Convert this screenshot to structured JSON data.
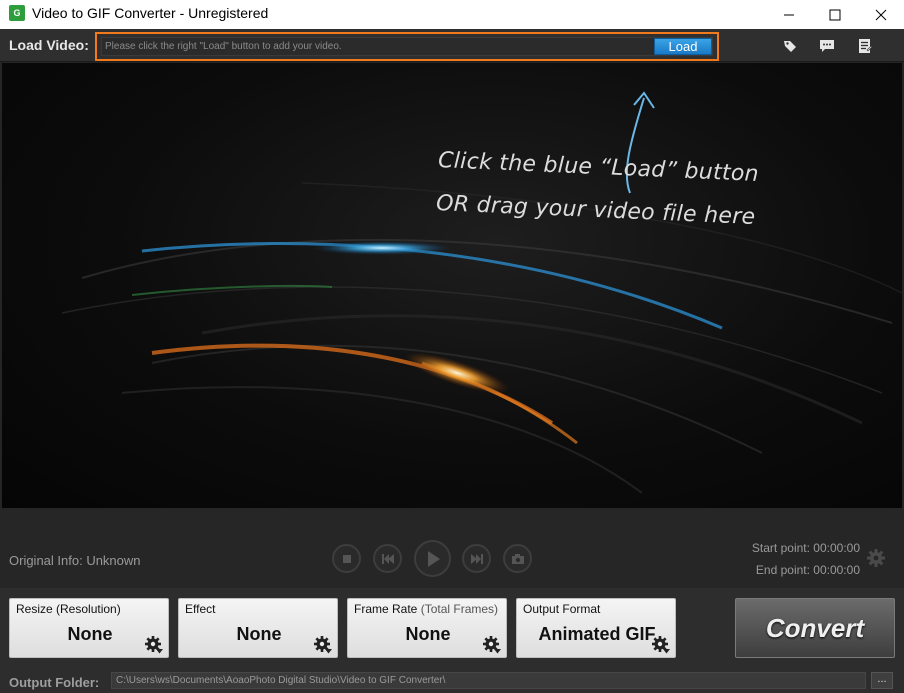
{
  "window": {
    "logo_text": "G",
    "title": "Video to GIF Converter - Unregistered"
  },
  "load_bar": {
    "label": "Load Video:",
    "placeholder": "Please click the right \"Load\" button to add your video.",
    "button_label": "Load",
    "icons": [
      "tag-icon",
      "chat-icon",
      "notes-icon"
    ]
  },
  "preview": {
    "hint_line1": "Click the blue “Load” button",
    "hint_line2": "OR drag your video file here"
  },
  "info": {
    "original_info": "Original Info: Unknown",
    "start_point": "Start point: 00:00:00",
    "end_point": "End point: 00:00:00"
  },
  "playback": [
    "stop-icon",
    "previous-frame-icon",
    "play-icon",
    "next-frame-icon",
    "snapshot-icon"
  ],
  "options": {
    "resize": {
      "title": "Resize (Resolution)",
      "value": "None"
    },
    "effect": {
      "title": "Effect",
      "value": "None"
    },
    "frame_rate": {
      "title": "Frame Rate",
      "title_sub": "(Total Frames)",
      "value": "None"
    },
    "output_format": {
      "title": "Output Format",
      "value": "Animated GIF"
    }
  },
  "convert_label": "Convert",
  "output": {
    "label": "Output Folder:",
    "path": "C:\\Users\\ws\\Documents\\AoaoPhoto Digital Studio\\Video to GIF Converter\\",
    "browse_label": "..."
  },
  "colors": {
    "accent_orange": "#f07a1c",
    "load_blue": "#1b79c7",
    "background": "#252525"
  }
}
